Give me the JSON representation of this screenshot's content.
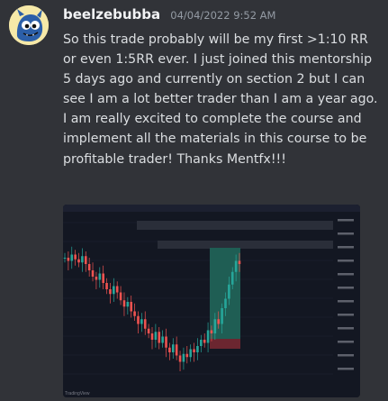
{
  "message": {
    "author": "beelzebubba",
    "timestamp": "04/04/2022 9:52 AM",
    "text": "So this trade probably will be my first >1:10 RR or even 1:5RR  ever. I just joined this mentorship 5 days ago and currently on section 2 but I can see I am a lot better trader than I am a year ago. I am really excited to complete the course and implement all the materials in this course to be profitable trader! Thanks Mentfx!!!",
    "avatar_icon": "blue-demon-avatar-icon"
  },
  "attachment": {
    "type": "trading-chart-screenshot",
    "watermark": "TradingView",
    "chart_data": {
      "type": "candlestick",
      "description_hint": "price declines then reverses sharply upward into a long position zone",
      "price_path": [
        72,
        70,
        74,
        71,
        69,
        73,
        68,
        64,
        60,
        58,
        62,
        56,
        52,
        49,
        54,
        50,
        45,
        41,
        44,
        38,
        35,
        30,
        33,
        27,
        24,
        20,
        25,
        18,
        22,
        15,
        12,
        17,
        10,
        6,
        11,
        9,
        14,
        12,
        16,
        20,
        18,
        26,
        24,
        33,
        30,
        40,
        46,
        55,
        63,
        70,
        68
      ],
      "zones": {
        "profit": {
          "color": "#1f5e54"
        },
        "loss": {
          "color": "#6b2630"
        }
      },
      "colors": {
        "up": "#26a69a",
        "down": "#ef5350",
        "background": "#131722"
      }
    }
  }
}
